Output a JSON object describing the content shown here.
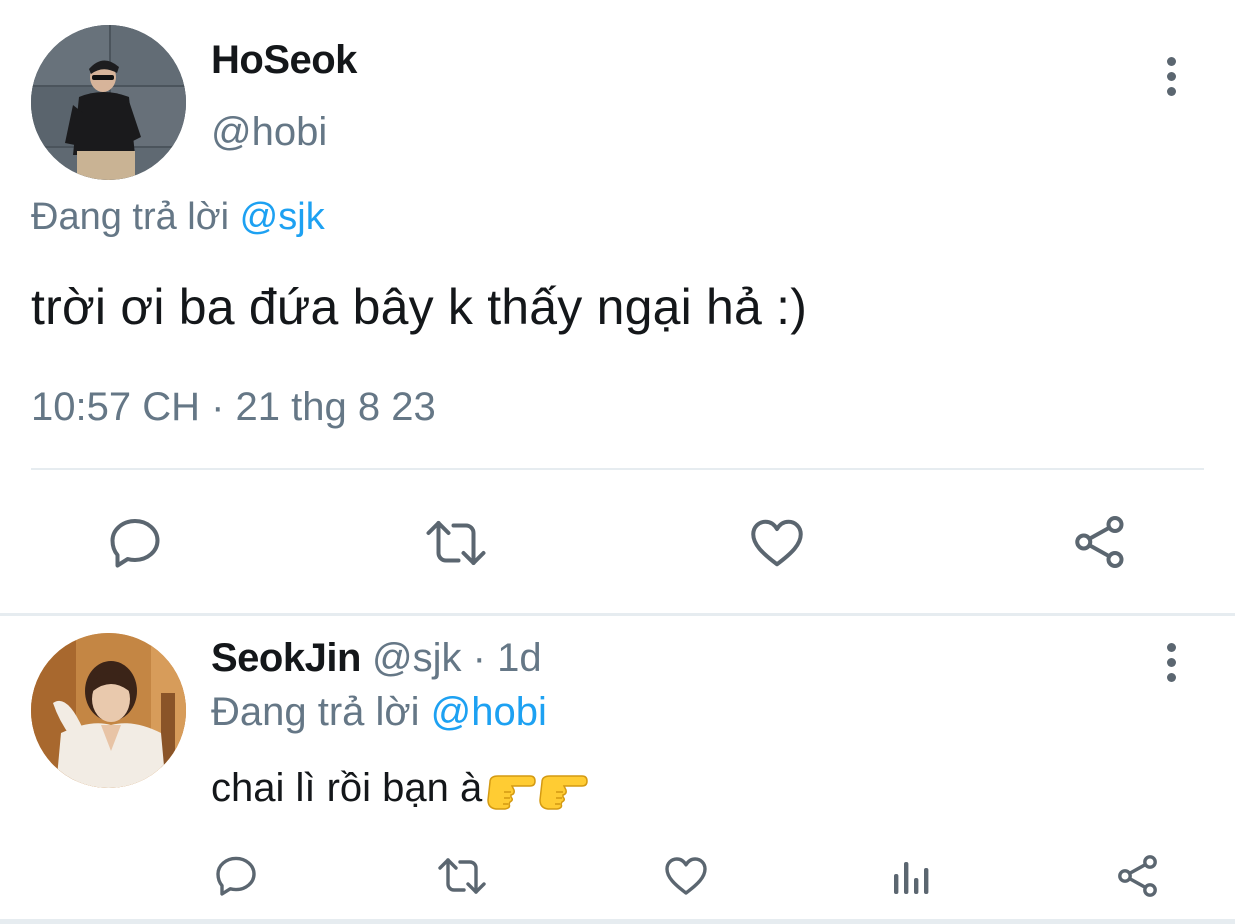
{
  "main_tweet": {
    "display_name": "HoSeok",
    "handle": "@hobi",
    "replying_prefix": "Đang trả lời",
    "replying_to": "@sjk",
    "text": "trời ơi ba đứa bây k thấy ngại hả :)",
    "timestamp": "10:57 CH · 21 thg 8 23",
    "actions": [
      "reply-icon",
      "retweet-icon",
      "like-icon",
      "share-icon"
    ]
  },
  "reply_tweet": {
    "display_name": "SeokJin",
    "handle": "@sjk",
    "separator": "·",
    "time": "1d",
    "replying_prefix": "Đang trả lời",
    "replying_to": "@hobi",
    "text": "chai lì rồi bạn à",
    "emoji": [
      "backhand-index-pointing-right",
      "backhand-index-pointing-right"
    ],
    "actions": [
      "reply-icon",
      "retweet-icon",
      "like-icon",
      "analytics-icon",
      "share-icon"
    ]
  },
  "colors": {
    "text_primary": "#14171a",
    "text_secondary": "#657786",
    "mention": "#1da1f2",
    "divider": "#e6ecf0",
    "icon": "#5b6670"
  }
}
